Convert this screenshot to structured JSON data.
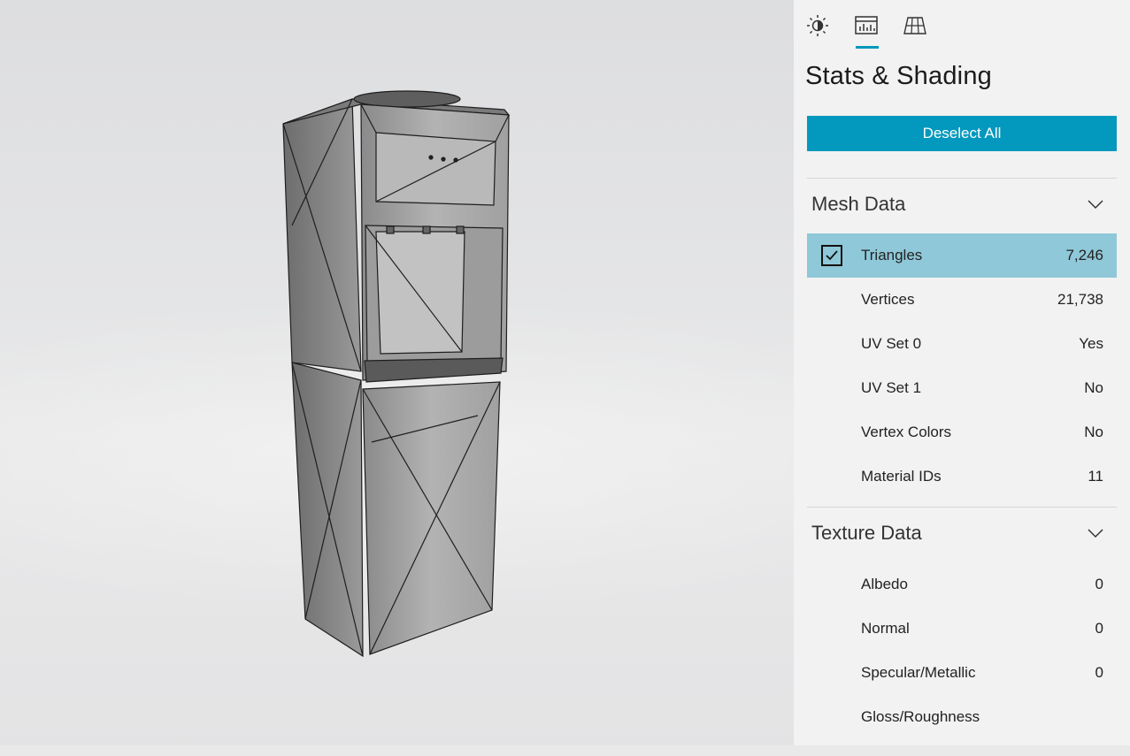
{
  "panel": {
    "tabs": [
      {
        "icon": "lighting-icon",
        "active": false
      },
      {
        "icon": "stats-icon",
        "active": true
      },
      {
        "icon": "grid-icon",
        "active": false
      }
    ],
    "title": "Stats & Shading",
    "deselect_label": "Deselect All",
    "accent_color": "#0398bd",
    "selected_row_color": "#8fc8d8"
  },
  "mesh": {
    "header": "Mesh Data",
    "rows": [
      {
        "name": "Triangles",
        "value": "7,246",
        "selected": true
      },
      {
        "name": "Vertices",
        "value": "21,738"
      },
      {
        "name": "UV Set 0",
        "value": "Yes"
      },
      {
        "name": "UV Set 1",
        "value": "No"
      },
      {
        "name": "Vertex Colors",
        "value": "No"
      },
      {
        "name": "Material IDs",
        "value": "11"
      }
    ]
  },
  "texture": {
    "header": "Texture Data",
    "rows": [
      {
        "name": "Albedo",
        "value": "0"
      },
      {
        "name": "Normal",
        "value": "0"
      },
      {
        "name": "Specular/Metallic",
        "value": "0"
      },
      {
        "name": "Gloss/Roughness",
        "value": ""
      }
    ]
  },
  "viewport": {
    "model": "water-dispenser-wireframe"
  }
}
